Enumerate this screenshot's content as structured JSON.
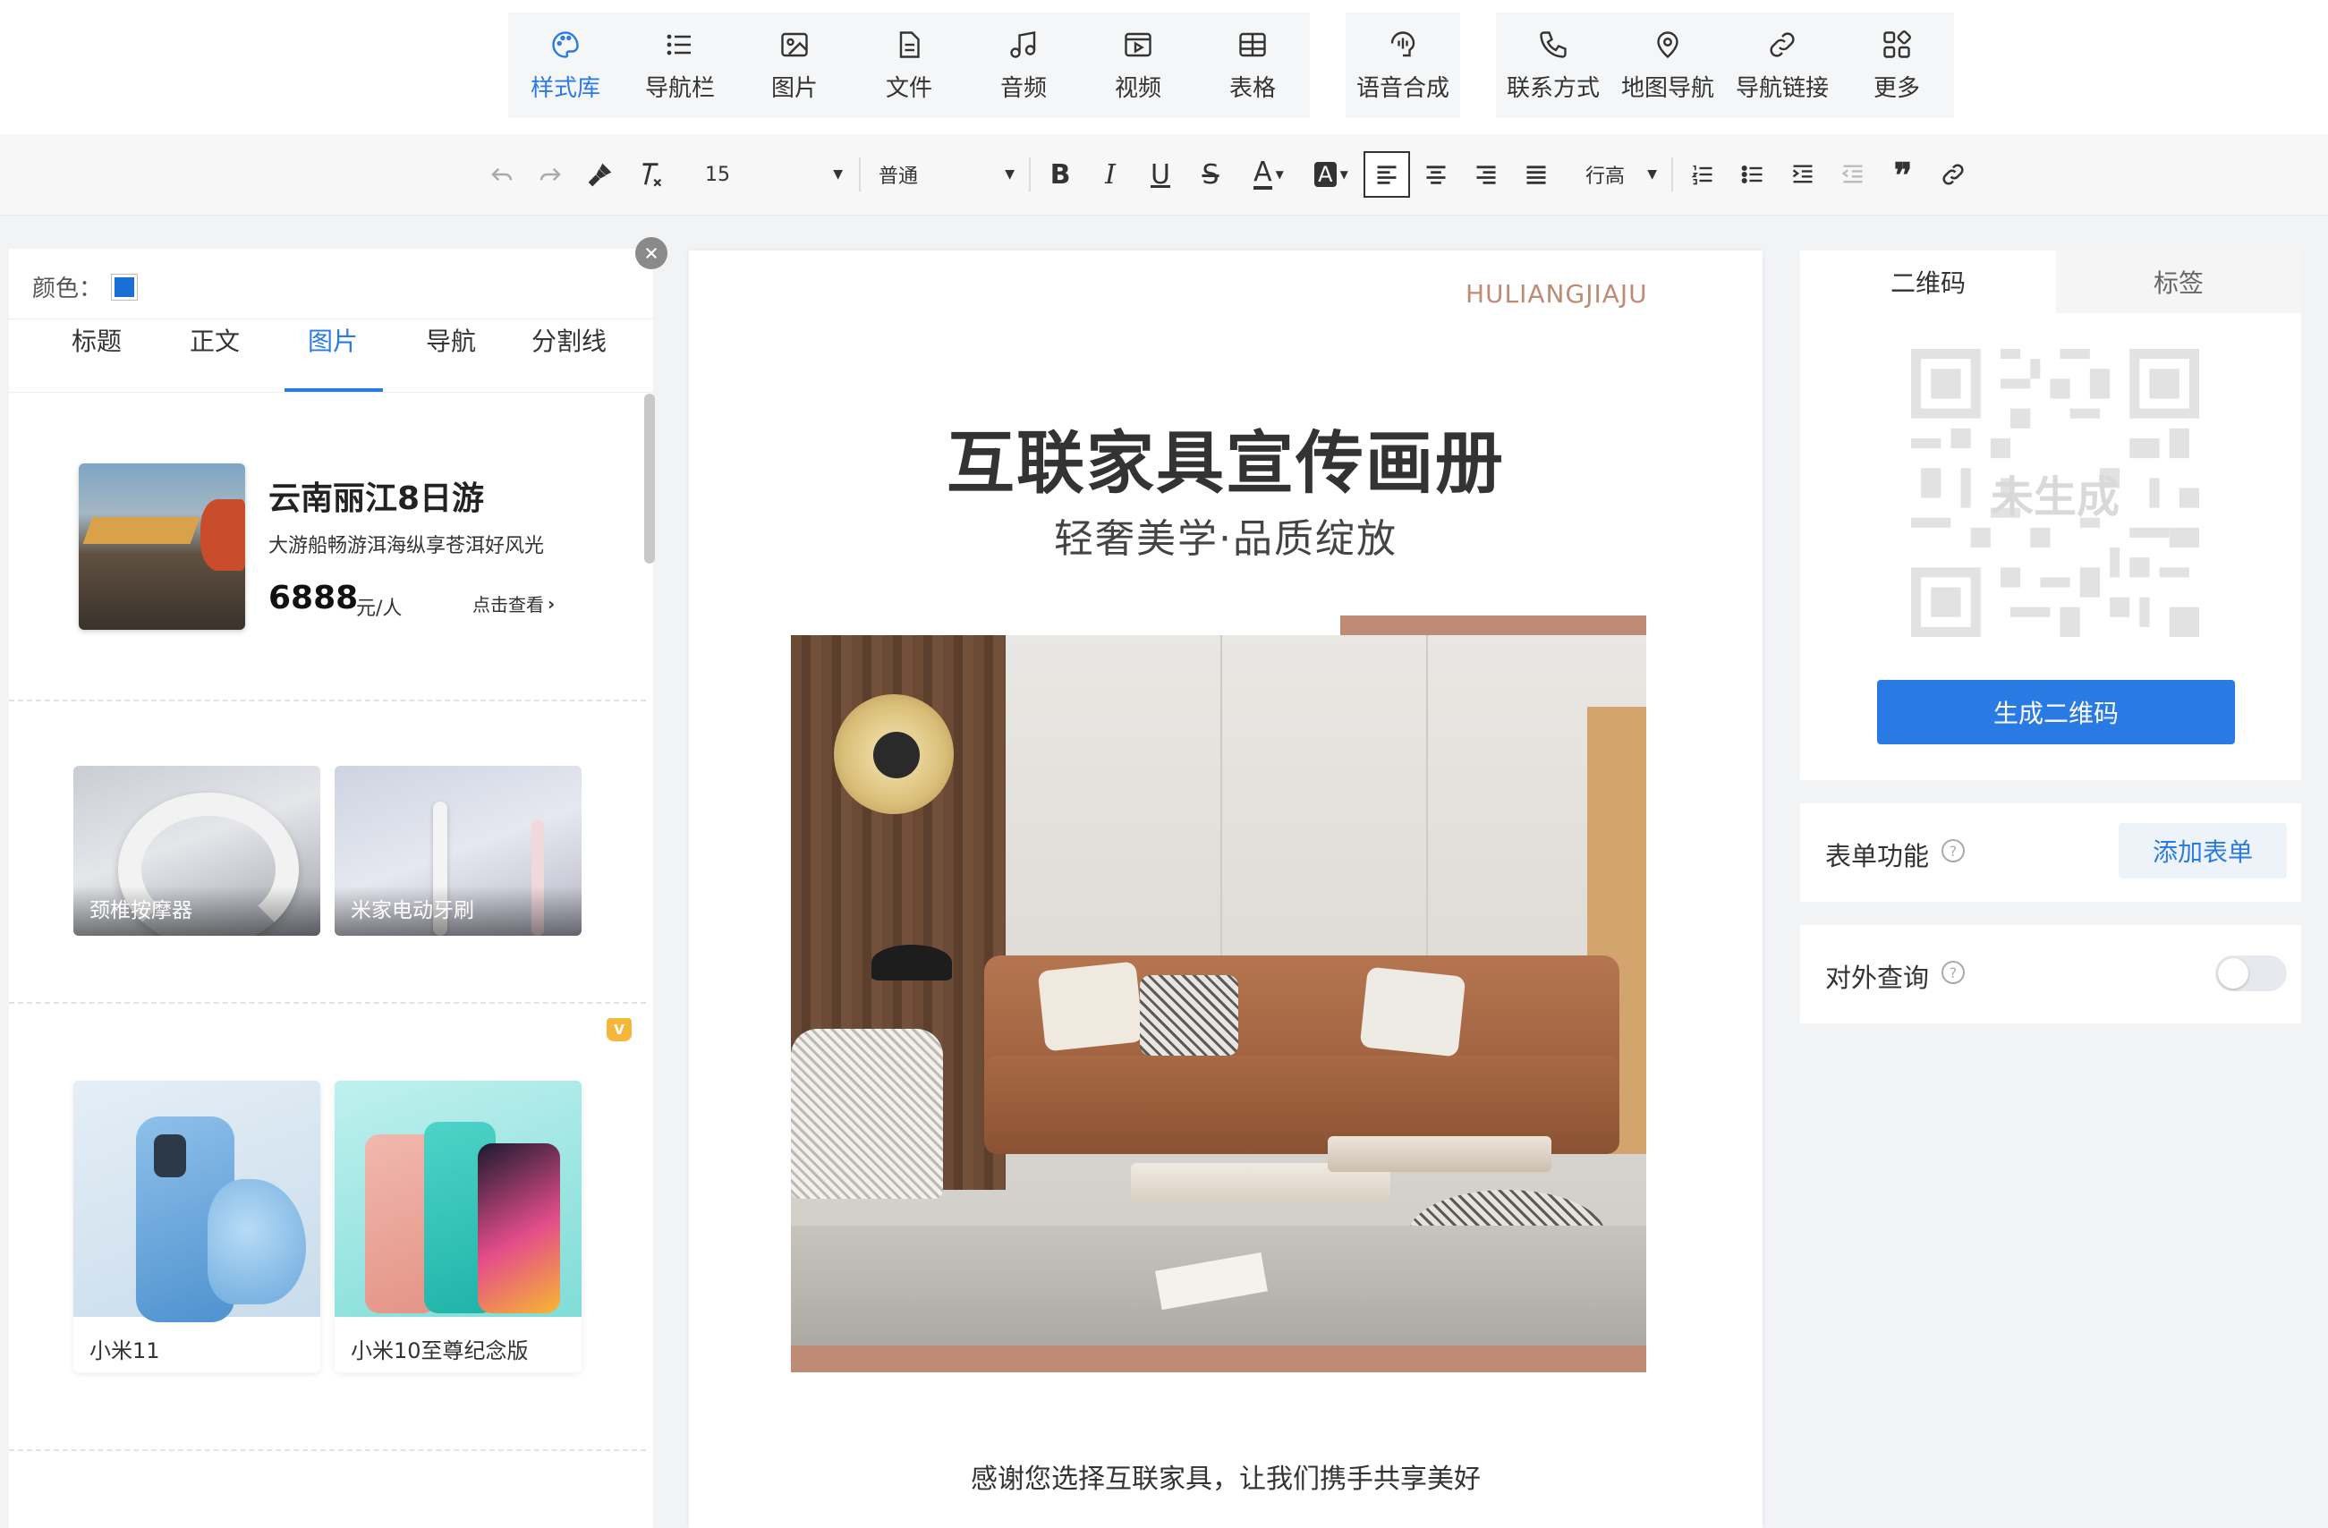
{
  "toolbar": {
    "items": [
      {
        "label": "样式库",
        "icon": "palette-icon"
      },
      {
        "label": "导航栏",
        "icon": "list-icon"
      },
      {
        "label": "图片",
        "icon": "image-icon"
      },
      {
        "label": "文件",
        "icon": "file-icon"
      },
      {
        "label": "音频",
        "icon": "music-icon"
      },
      {
        "label": "视频",
        "icon": "video-icon"
      },
      {
        "label": "表格",
        "icon": "table-icon"
      },
      {
        "label": "语音合成",
        "icon": "voice-icon"
      },
      {
        "label": "联系方式",
        "icon": "phone-icon"
      },
      {
        "label": "地图导航",
        "icon": "map-pin-icon"
      },
      {
        "label": "导航链接",
        "icon": "link-icon"
      },
      {
        "label": "更多",
        "icon": "grid-more-icon"
      }
    ]
  },
  "format": {
    "font_size": "15",
    "paragraph": "普通",
    "line_height": "行高"
  },
  "left_panel": {
    "color_label": "颜色：",
    "color_value": "#1a6fd4",
    "tabs": [
      "标题",
      "正文",
      "图片",
      "导航",
      "分割线"
    ],
    "active_tab": "图片",
    "card1": {
      "title": "云南丽江8日游",
      "subtitle": "大游船畅游洱海纵享苍洱好风光",
      "price": "6888",
      "unit": "元/人",
      "link": "点击查看"
    },
    "card2": {
      "items": [
        "颈椎按摩器",
        "米家电动牙刷"
      ]
    },
    "card3": {
      "badge": "V",
      "items": [
        "小米11",
        "小米10至尊纪念版"
      ]
    }
  },
  "canvas": {
    "brand": "HULIANGJIAJU",
    "title": "互联家具宣传画册",
    "subtitle": "轻奢美学·品质绽放",
    "caption": "感谢您选择互联家具，让我们携手共享美好"
  },
  "right_panel": {
    "tabs": [
      "二维码",
      "标签"
    ],
    "qr_placeholder": "未生成",
    "generate_button": "生成二维码",
    "form_label": "表单功能",
    "form_button": "添加表单",
    "query_label": "对外查询",
    "query_enabled": false
  },
  "colors": {
    "accent": "#2a7ae4",
    "brand_copper": "#c08b74"
  }
}
